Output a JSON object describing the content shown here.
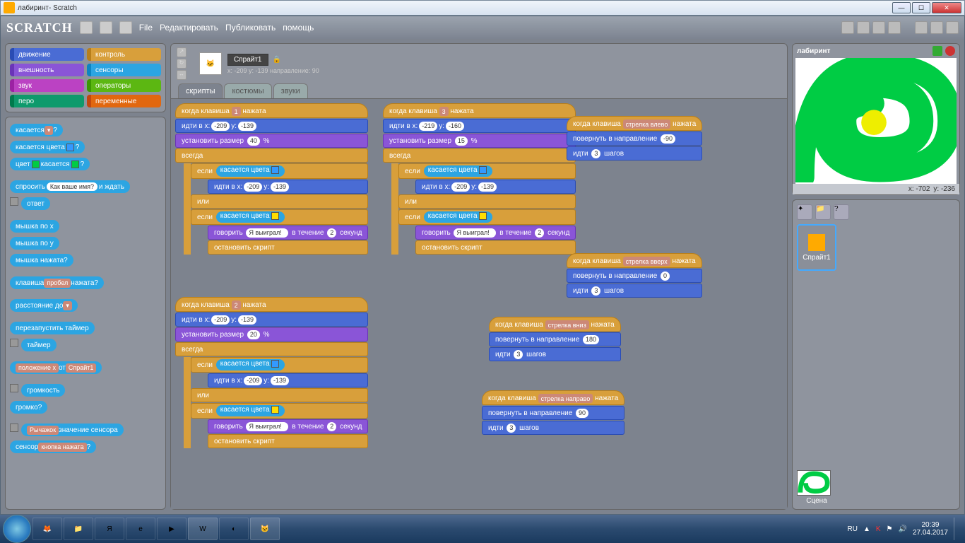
{
  "window": {
    "title": "лабиринт- Scratch"
  },
  "menubar": {
    "logo": "SCRATCH",
    "items": [
      "File",
      "Редактировать",
      "Публиковать",
      "помощь"
    ]
  },
  "categories": [
    [
      "движение",
      "motion"
    ],
    [
      "контроль",
      "control"
    ],
    [
      "внешность",
      "looks"
    ],
    [
      "сенсоры",
      "sensing"
    ],
    [
      "звук",
      "sound"
    ],
    [
      "операторы",
      "operators"
    ],
    [
      "перо",
      "pen"
    ],
    [
      "переменные",
      "variables"
    ]
  ],
  "palette": {
    "touching": "касается",
    "touching_color": "касается цвета",
    "color_touching": "цвет",
    "touching2": "касается",
    "ask": "спросить",
    "ask_default": "Как ваше имя?",
    "and_wait": "и ждать",
    "answer": "ответ",
    "mouse_x": "мышка по x",
    "mouse_y": "мышка по y",
    "mouse_down": "мышка нажата?",
    "key": "клавиша",
    "key_space": "пробел",
    "pressed": "нажата?",
    "distance": "расстояние до",
    "reset_timer": "перезапустить таймер",
    "timer": "таймер",
    "prop": "положение x",
    "of": "от",
    "sprite1": "Спрайт1",
    "loudness": "громкость",
    "loud": "громко?",
    "slider": "Рычажок",
    "sensor_val": "значение сенсора",
    "sensor": "сенсор",
    "btn_pressed": "кнопка нажата"
  },
  "sprite": {
    "name": "Спрайт1",
    "info": "x: -209  y: -139 направление: 90",
    "lock": "🔒"
  },
  "tabs": [
    "скрипты",
    "костюмы",
    "звуки"
  ],
  "b": {
    "when_key": "когда клавиша",
    "pressed": "нажата",
    "goto": "идти в x:",
    "y": "y:",
    "set_size": "установить размер",
    "pct": "%",
    "forever": "всегда",
    "if": "если",
    "or": "или",
    "touching_color": "касается цвета",
    "say": "говорить",
    "won": "Я выиграл!",
    "for": "в течение",
    "sec": "секунд",
    "stop": "остановить скрипт",
    "point_dir": "повернуть в направление",
    "move": "идти",
    "steps": "шагов",
    "arrow_left": "стрелка влево",
    "arrow_up": "стрелка вверх",
    "arrow_down": "стрелка вниз",
    "arrow_right": "стрелка направо"
  },
  "scripts": {
    "s1": {
      "key": "1",
      "x": "-209",
      "y": "-139",
      "size": "40",
      "say_n": "2"
    },
    "s2": {
      "key": "2",
      "x": "-209",
      "y": "-139",
      "size": "20",
      "say_n": "2"
    },
    "s3": {
      "key": "3",
      "x": "-219",
      "y": "-160",
      "gx": "-209",
      "gy": "-139",
      "size": "15",
      "say_n": "2"
    },
    "left": {
      "dir": "-90",
      "steps": "3"
    },
    "up": {
      "dir": "0",
      "steps": "3"
    },
    "down": {
      "dir": "180",
      "steps": "3"
    },
    "right": {
      "dir": "90",
      "steps": "3"
    }
  },
  "stage": {
    "title": "лабиринт",
    "coords_x": "x: -702",
    "coords_y": "y: -236",
    "scene": "Сцена"
  },
  "taskbar": {
    "lang": "RU",
    "time": "20:39",
    "date": "27.04.2017"
  }
}
